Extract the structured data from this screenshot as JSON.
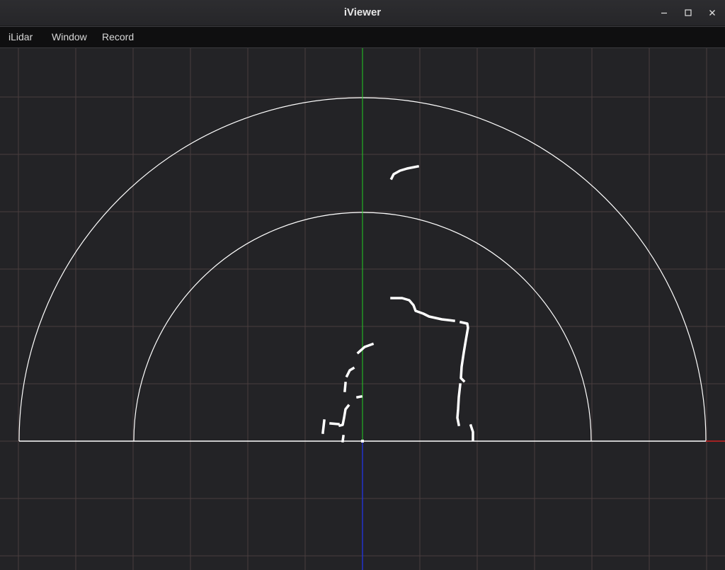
{
  "window": {
    "title": "iViewer",
    "controls": {
      "minimize": "minimize-icon",
      "maximize": "maximize-icon",
      "close": "close-icon"
    }
  },
  "menu": {
    "items": [
      {
        "label": "iLidar"
      },
      {
        "label": "Window"
      },
      {
        "label": "Record"
      }
    ]
  },
  "viewer": {
    "colors": {
      "background": "#232326",
      "grid": "#4a3e3e",
      "range_rings": "#ffffff",
      "scan_points": "#ffffff",
      "y_axis": "#22cc22",
      "x_axis": "#cc2222",
      "z_axis": "#2233cc"
    }
  }
}
